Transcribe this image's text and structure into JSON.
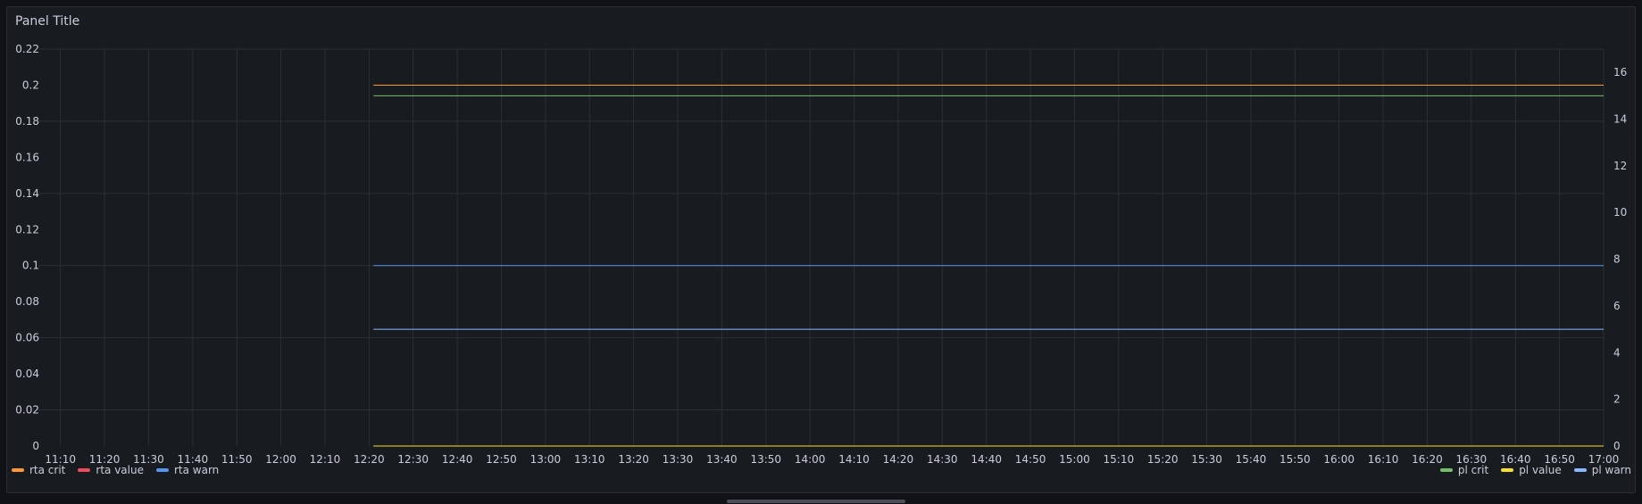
{
  "panel": {
    "title": "Panel Title"
  },
  "colors": {
    "rta_crit": "#ff9830",
    "rta_value": "#f2495c",
    "rta_warn": "#5794f2",
    "pl_crit": "#73bf69",
    "pl_value": "#fade2a",
    "pl_warn": "#8ab8ff",
    "grid": "#2c2f36"
  },
  "legend": {
    "left": [
      {
        "label": "rta crit",
        "color_key": "rta_crit"
      },
      {
        "label": "rta value",
        "color_key": "rta_value"
      },
      {
        "label": "rta warn",
        "color_key": "rta_warn"
      }
    ],
    "right": [
      {
        "label": "pl crit",
        "color_key": "pl_crit"
      },
      {
        "label": "pl value",
        "color_key": "pl_value"
      },
      {
        "label": "pl warn",
        "color_key": "pl_warn"
      }
    ]
  },
  "chart_data": {
    "type": "line",
    "title": "Panel Title",
    "x_ticks": [
      "11:10",
      "11:20",
      "11:30",
      "11:40",
      "11:50",
      "12:00",
      "12:10",
      "12:20",
      "12:30",
      "12:40",
      "12:50",
      "13:00",
      "13:10",
      "13:20",
      "13:30",
      "13:40",
      "13:50",
      "14:00",
      "14:10",
      "14:20",
      "14:30",
      "14:40",
      "14:50",
      "15:00",
      "15:10",
      "15:20",
      "15:30",
      "15:40",
      "15:50",
      "16:00",
      "16:10",
      "16:20",
      "16:30",
      "16:40",
      "16:50",
      "17:00"
    ],
    "x_range": [
      "11:05",
      "17:00"
    ],
    "y_left": {
      "ticks": [
        "0",
        "0.02",
        "0.04",
        "0.06",
        "0.08",
        "0.1",
        "0.12",
        "0.14",
        "0.16",
        "0.18",
        "0.2",
        "0.22"
      ],
      "range": [
        0,
        0.22
      ]
    },
    "y_right": {
      "ticks": [
        "0",
        "2",
        "4",
        "6",
        "8",
        "10",
        "12",
        "14",
        "16"
      ],
      "range": [
        0,
        17
      ]
    },
    "grid": true,
    "series": [
      {
        "name": "rta crit",
        "axis": "left",
        "color_key": "rta_crit",
        "x": [
          "12:21",
          "17:00"
        ],
        "values": [
          0.2,
          0.2
        ]
      },
      {
        "name": "rta value",
        "axis": "left",
        "color_key": "rta_value",
        "x": [
          "12:21",
          "17:00"
        ],
        "values": [
          0,
          0
        ]
      },
      {
        "name": "rta warn",
        "axis": "left",
        "color_key": "rta_warn",
        "x": [
          "12:21",
          "17:00"
        ],
        "values": [
          0.1,
          0.1
        ]
      },
      {
        "name": "pl crit",
        "axis": "right",
        "color_key": "pl_crit",
        "x": [
          "12:21",
          "17:00"
        ],
        "values": [
          15,
          15
        ]
      },
      {
        "name": "pl value",
        "axis": "right",
        "color_key": "pl_value",
        "x": [
          "12:21",
          "17:00"
        ],
        "values": [
          0,
          0
        ]
      },
      {
        "name": "pl warn",
        "axis": "right",
        "color_key": "pl_warn",
        "x": [
          "12:21",
          "17:00"
        ],
        "values": [
          5,
          5
        ]
      }
    ]
  }
}
